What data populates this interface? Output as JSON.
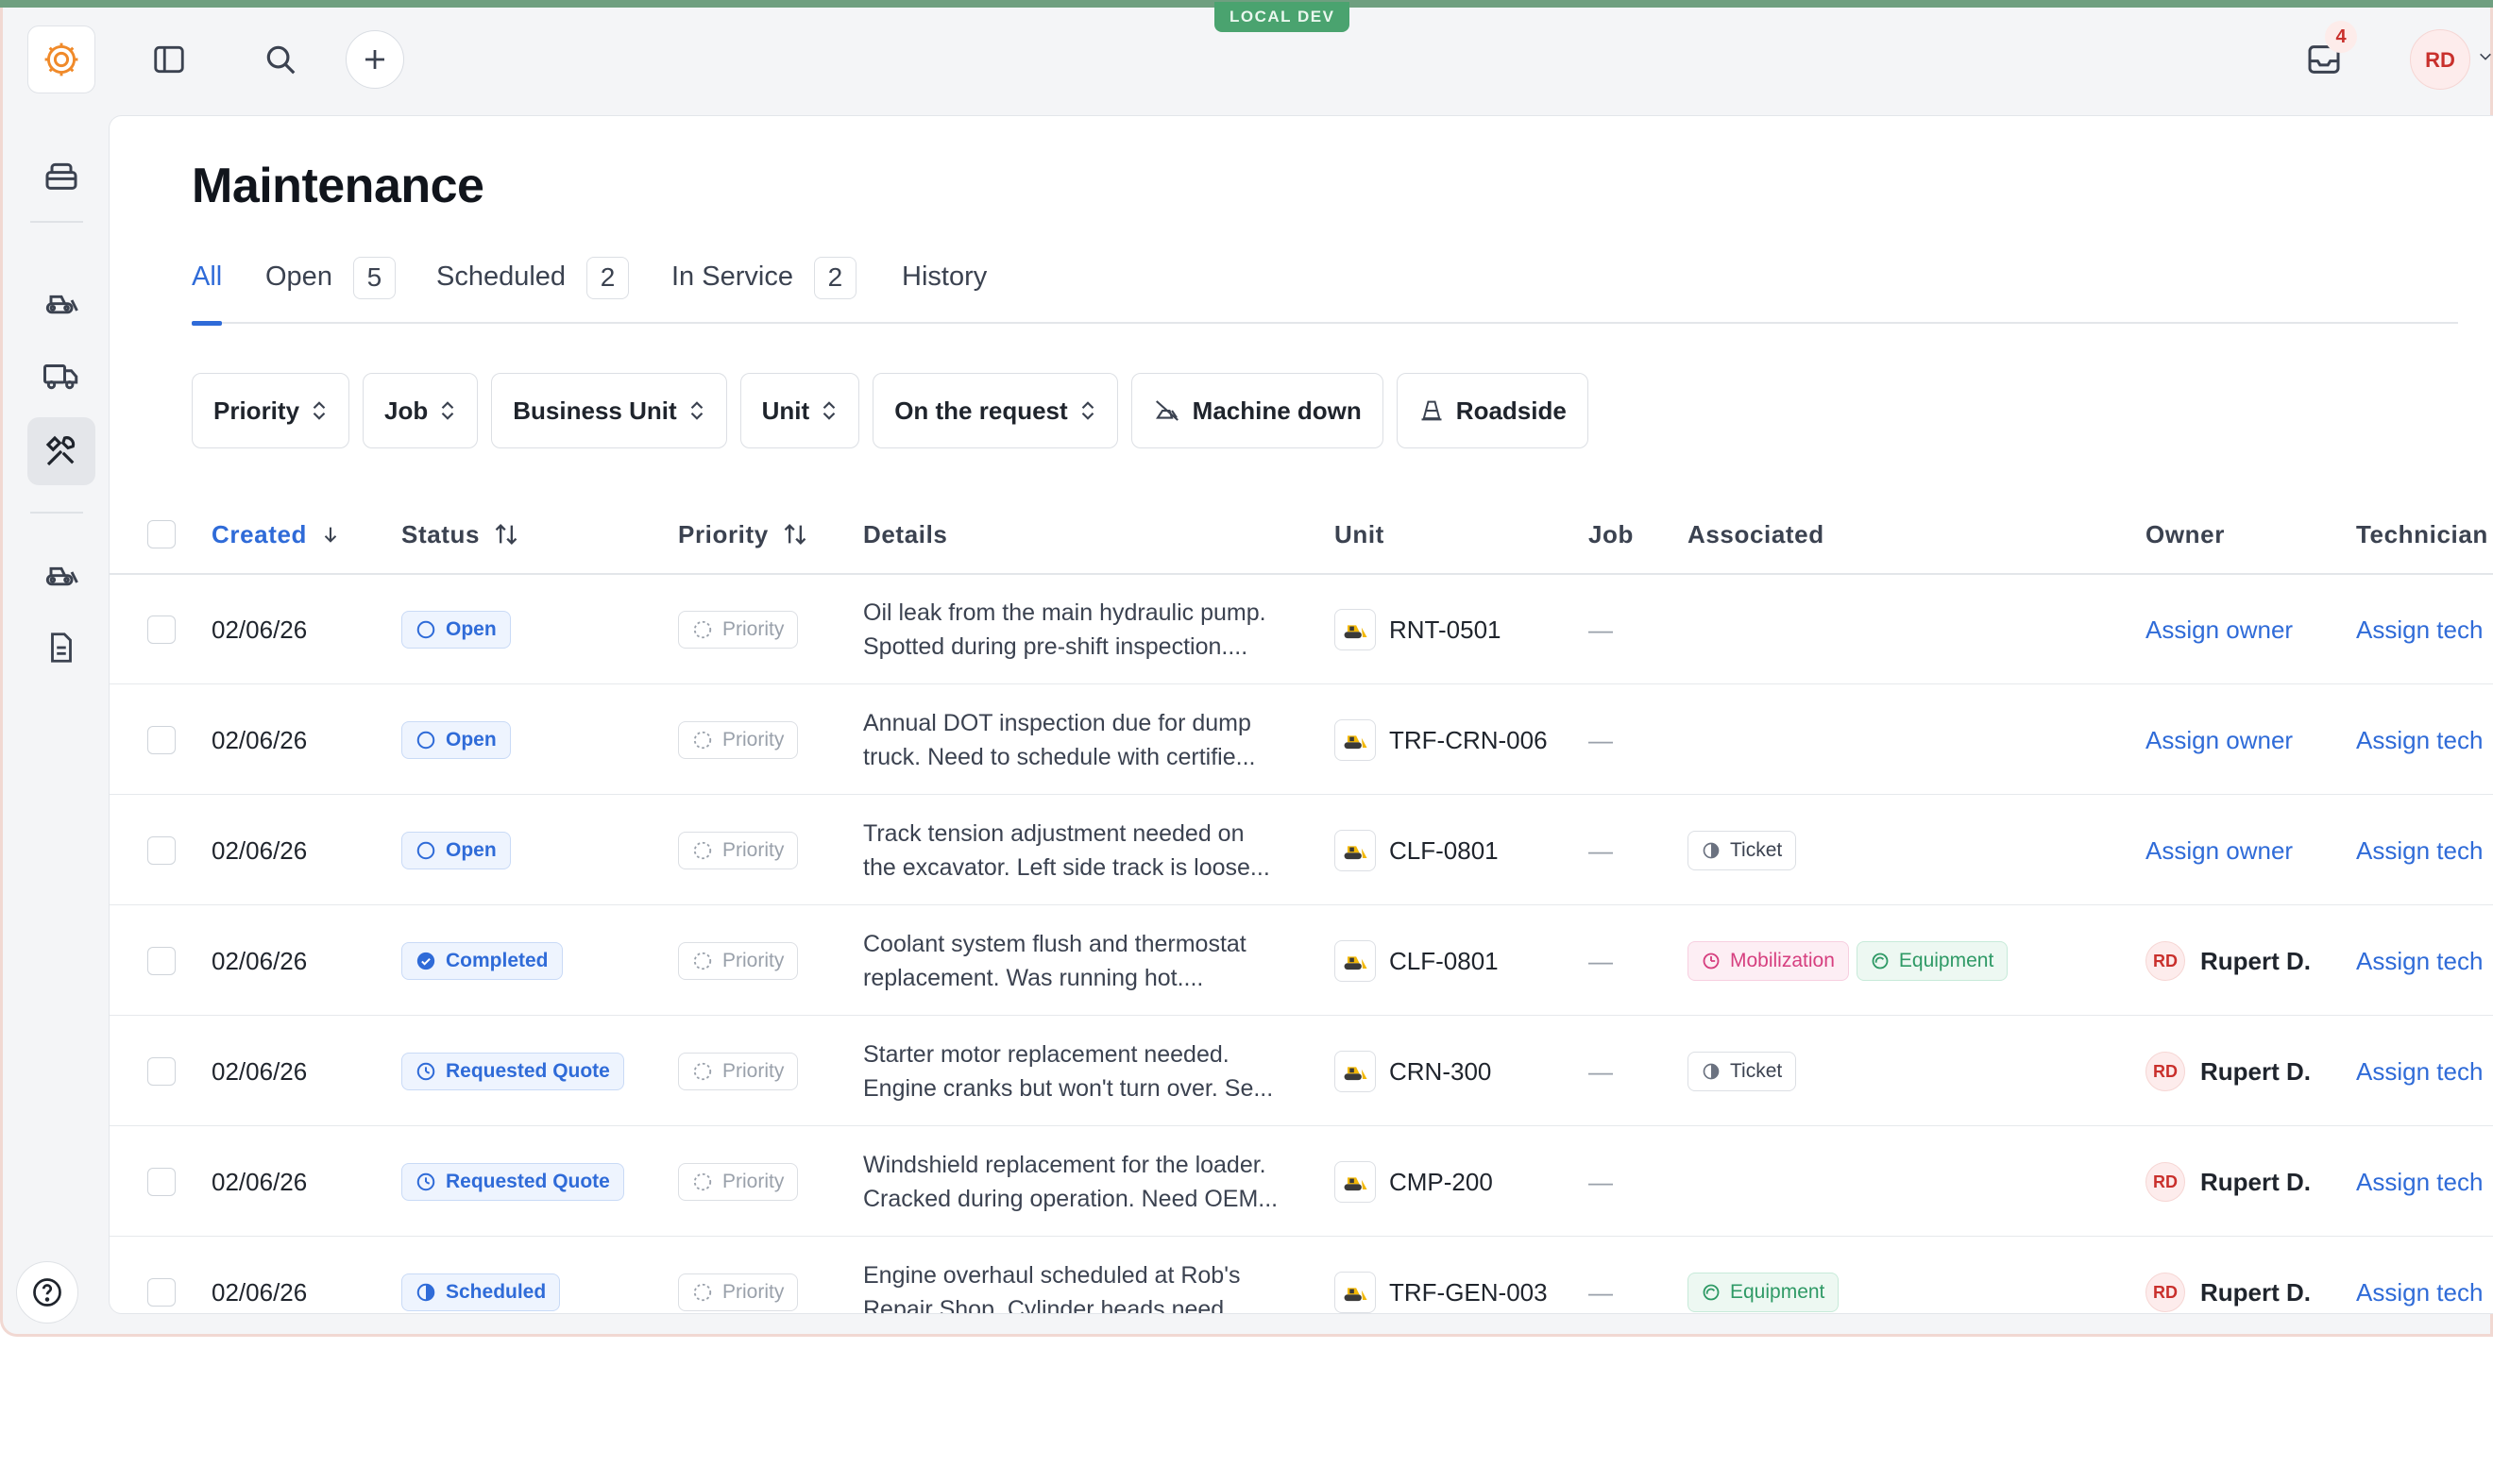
{
  "env_badge": "LOCAL DEV",
  "topbar": {
    "inbox_count": "4",
    "user_initials": "RD"
  },
  "page": {
    "title": "Maintenance"
  },
  "tabs": [
    {
      "label": "All",
      "count": ""
    },
    {
      "label": "Open",
      "count": "5"
    },
    {
      "label": "Scheduled",
      "count": "2"
    },
    {
      "label": "In Service",
      "count": "2"
    },
    {
      "label": "History",
      "count": ""
    }
  ],
  "filters": {
    "priority": "Priority",
    "job": "Job",
    "business_unit": "Business Unit",
    "unit": "Unit",
    "on_request": "On the request",
    "machine_down": "Machine down",
    "roadside": "Roadside"
  },
  "columns": {
    "created": "Created",
    "status": "Status",
    "priority": "Priority",
    "details": "Details",
    "unit": "Unit",
    "job": "Job",
    "associated": "Associated",
    "owner": "Owner",
    "technician": "Technician"
  },
  "rows": [
    {
      "created": "02/06/26",
      "status": "Open",
      "priority": "Priority",
      "details": "Oil leak from the main hydraulic pump. Spotted during pre-shift inspection....",
      "unit": "RNT-0501",
      "job": "—",
      "tag1": "",
      "tag2": "",
      "owner_initials": "",
      "owner": "Assign owner",
      "tech": "Assign tech"
    },
    {
      "created": "02/06/26",
      "status": "Open",
      "priority": "Priority",
      "details": "Annual DOT inspection due for dump truck. Need to schedule with certifie...",
      "unit": "TRF-CRN-006",
      "job": "—",
      "tag1": "",
      "tag2": "",
      "owner_initials": "",
      "owner": "Assign owner",
      "tech": "Assign tech"
    },
    {
      "created": "02/06/26",
      "status": "Open",
      "priority": "Priority",
      "details": "Track tension adjustment needed on the excavator. Left side track is loose...",
      "unit": "CLF-0801",
      "job": "—",
      "tag1": "Ticket",
      "tag2": "",
      "owner_initials": "",
      "owner": "Assign owner",
      "tech": "Assign tech"
    },
    {
      "created": "02/06/26",
      "status": "Completed",
      "priority": "Priority",
      "details": "Coolant system flush and thermostat replacement. Was running hot....",
      "unit": "CLF-0801",
      "job": "—",
      "tag1": "Mobilization",
      "tag2": "Equipment",
      "owner_initials": "RD",
      "owner": "Rupert D.",
      "tech": "Assign tech"
    },
    {
      "created": "02/06/26",
      "status": "Requested Quote",
      "priority": "Priority",
      "details": "Starter motor replacement needed. Engine cranks but won't turn over. Se...",
      "unit": "CRN-300",
      "job": "—",
      "tag1": "Ticket",
      "tag2": "",
      "owner_initials": "RD",
      "owner": "Rupert D.",
      "tech": "Assign tech"
    },
    {
      "created": "02/06/26",
      "status": "Requested Quote",
      "priority": "Priority",
      "details": "Windshield replacement for the loader. Cracked during operation. Need OEM...",
      "unit": "CMP-200",
      "job": "—",
      "tag1": "",
      "tag2": "",
      "owner_initials": "RD",
      "owner": "Rupert D.",
      "tech": "Assign tech"
    },
    {
      "created": "02/06/26",
      "status": "Scheduled",
      "priority": "Priority",
      "details": "Engine overhaul scheduled at Rob's Repair Shop. Cylinder heads need",
      "unit": "TRF-GEN-003",
      "job": "—",
      "tag1": "Equipment",
      "tag2": "",
      "owner_initials": "RD",
      "owner": "Rupert D.",
      "tech": "Assign tech"
    }
  ],
  "icons": {
    "logo": "gear-logo-icon",
    "sidebar_toggle": "sidebar-toggle-icon",
    "search": "search-icon",
    "add": "plus-icon",
    "inbox": "inbox-icon"
  },
  "colors": {
    "accent": "#2f6bd8",
    "env_badge": "#4aa36f",
    "danger": "#c9302c"
  }
}
